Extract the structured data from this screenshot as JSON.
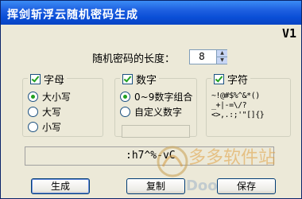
{
  "window": {
    "title": "挥剑斩浮云随机密码生成",
    "version": "V1"
  },
  "length": {
    "label": "随机密码的长度：",
    "value": "8"
  },
  "groups": {
    "letters": {
      "title": "字母",
      "options": [
        "大小写",
        "大写",
        "小写"
      ],
      "selected": 0
    },
    "digits": {
      "title": "数字",
      "options": [
        "0~9数字组合",
        "自定义数字"
      ],
      "selected": 0,
      "custom_value": ""
    },
    "symbols": {
      "title": "字符",
      "chars_line1": "~!@#$%^&*()",
      "chars_line2": "_+|-=\\/?",
      "chars_line3": "<>,.:;'\"[]{}"
    }
  },
  "output": {
    "value": ":h7^%-vC"
  },
  "buttons": {
    "generate": "生成",
    "copy": "复制",
    "save": "保存"
  },
  "watermark": {
    "text": "多多软件站",
    "site": "DDooo.com"
  }
}
